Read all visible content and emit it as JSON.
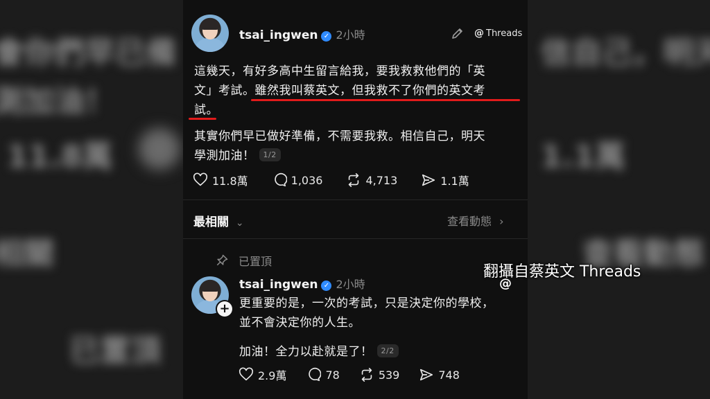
{
  "post": {
    "username": "tsai_ingwen",
    "time": "2小時",
    "app_label": "Threads",
    "paragraph1_line1": "這幾天，有好多高中生留言給我，要我救救他們的「英",
    "paragraph1_line2": "文」考試。雖然我叫蔡英文，但我救不了你們的英文考",
    "paragraph1_line3": "試。",
    "paragraph2_line1": "其實你們早已做好準備，不需要我救。相信自己，明天",
    "paragraph2_line2": "學測加油！",
    "pager": "1/2",
    "likes": "11.8萬",
    "replies": "1,036",
    "reposts": "4,713",
    "shares": "1.1萬"
  },
  "section": {
    "title": "最相關",
    "link": "查看動態"
  },
  "reply": {
    "pinned_label": "已置頂",
    "username": "tsai_ingwen",
    "time": "2小時",
    "line1": "更重要的是，一次的考試，只是決定你的學校，",
    "line2": "並不會決定你的人生。",
    "line3": "加油！全力以赴就是了！",
    "pager": "2/2",
    "likes": "2.9萬",
    "replies": "78",
    "reposts": "539",
    "shares": "748"
  },
  "caption": {
    "text": "翻攝自蔡英文 Threads",
    "icon": "@"
  },
  "colors": {
    "accent_underline": "#e21b1b",
    "verified": "#2f8bff"
  }
}
